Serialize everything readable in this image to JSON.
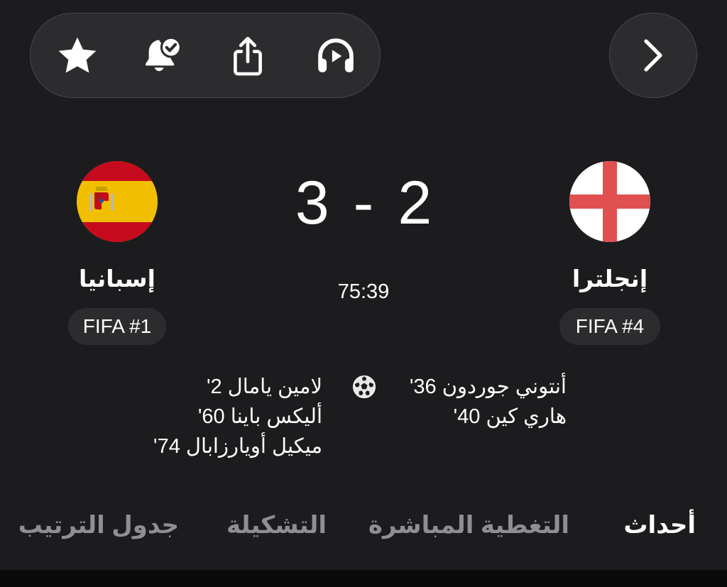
{
  "toolbar": {
    "icons": [
      "star-icon",
      "bell-check-icon",
      "share-icon",
      "headphones-play-icon"
    ],
    "forward_icon": "chevron-right-icon"
  },
  "match": {
    "home": {
      "name": "إسبانيا",
      "rank": "FIFA #1",
      "score": "3",
      "scorers": [
        "لامين يامال 2'",
        "أليكس باينا 60'",
        "ميكيل أويارزابال 74'"
      ],
      "flag_colors": [
        "#c60b1e",
        "#f1bf00"
      ]
    },
    "away": {
      "name": "إنجلترا",
      "rank": "FIFA #4",
      "score": "2",
      "scorers": [
        "أنتوني جوردون 36'",
        "هاري كين 40'"
      ],
      "flag_colors": [
        "#ffffff",
        "#e05050"
      ]
    },
    "score_separator": "-",
    "clock": "75:39",
    "goal_icon": "soccer-ball-icon"
  },
  "tabs": [
    {
      "label": "أحداث",
      "active": true
    },
    {
      "label": "التغطية المباشرة",
      "active": false
    },
    {
      "label": "التشكيلة",
      "active": false
    },
    {
      "label": "جدول الترتيب",
      "active": false
    }
  ],
  "colors": {
    "background": "#1c1c1e",
    "pill": "#2c2c2e",
    "inactive_tab": "#8e8e93",
    "text": "#ffffff"
  }
}
